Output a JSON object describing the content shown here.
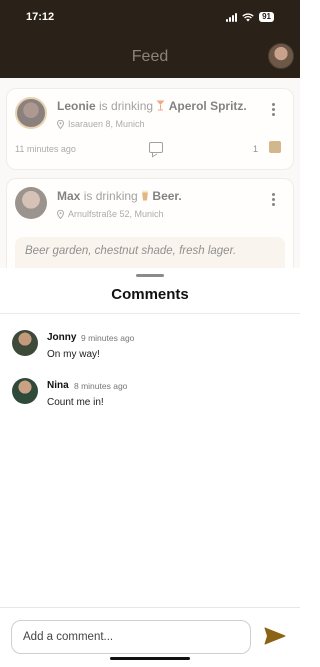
{
  "status_bar": {
    "time": "17:12",
    "battery": "91"
  },
  "app_bar": {
    "title": "Feed"
  },
  "feed": {
    "posts": [
      {
        "user": "Leonie",
        "verb": "is drinking",
        "drink": "Aperol Spritz.",
        "location": "Isarauen 8, Munich",
        "time": "11 minutes ago",
        "likes": "1"
      },
      {
        "user": "Max",
        "verb": "is drinking",
        "drink": "Beer.",
        "location": "Arnulfstraße 52, Munich",
        "quote": "Beer garden, chestnut shade, fresh lager."
      }
    ]
  },
  "comments_sheet": {
    "title": "Comments",
    "comments": [
      {
        "name": "Jonny",
        "time": "9 minutes ago",
        "text": "On my way!"
      },
      {
        "name": "Nina",
        "time": "8 minutes ago",
        "text": "Count me in!"
      }
    ],
    "input_placeholder": "Add a comment..."
  },
  "colors": {
    "header_bg": "#2a2119",
    "accent": "#8a6414"
  },
  "icons": [
    "location-pin-icon",
    "comment-icon",
    "beer-mug-icon",
    "more-vert-icon",
    "send-icon",
    "cocktail-icon",
    "beer-icon"
  ]
}
